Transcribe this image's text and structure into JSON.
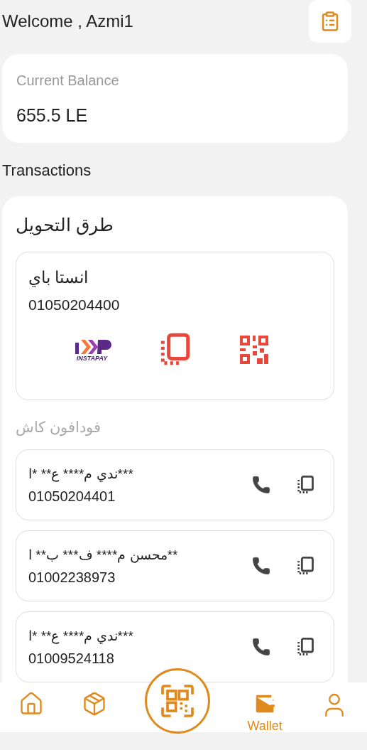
{
  "header": {
    "greeting": "Welcome , Azmi1"
  },
  "balance": {
    "label": "Current Balance",
    "amount": "655.5 LE"
  },
  "transactions_title": "Transactions",
  "transfer_methods": {
    "title": "طرق التحويل",
    "instapay": {
      "name": "انستا باي",
      "number": "01050204400",
      "logo_text": "INSTAPAY"
    },
    "vodafone_cash": {
      "title": "فودافون كاش",
      "accounts": [
        {
          "name": "***ندي م**** ع** *ا",
          "number": "01050204401"
        },
        {
          "name": "**محسن م**** ف*** ب** ا",
          "number": "01002238973"
        },
        {
          "name": "***ندي م**** ع** *ا",
          "number": "01009524118"
        }
      ]
    }
  },
  "nav": [
    {
      "kind": "home",
      "selected": false
    },
    {
      "kind": "package",
      "selected": false
    },
    {
      "kind": "scan",
      "selected": false
    },
    {
      "kind": "wallet",
      "label": "Wallet",
      "selected": true
    },
    {
      "kind": "profile",
      "selected": false
    }
  ]
}
